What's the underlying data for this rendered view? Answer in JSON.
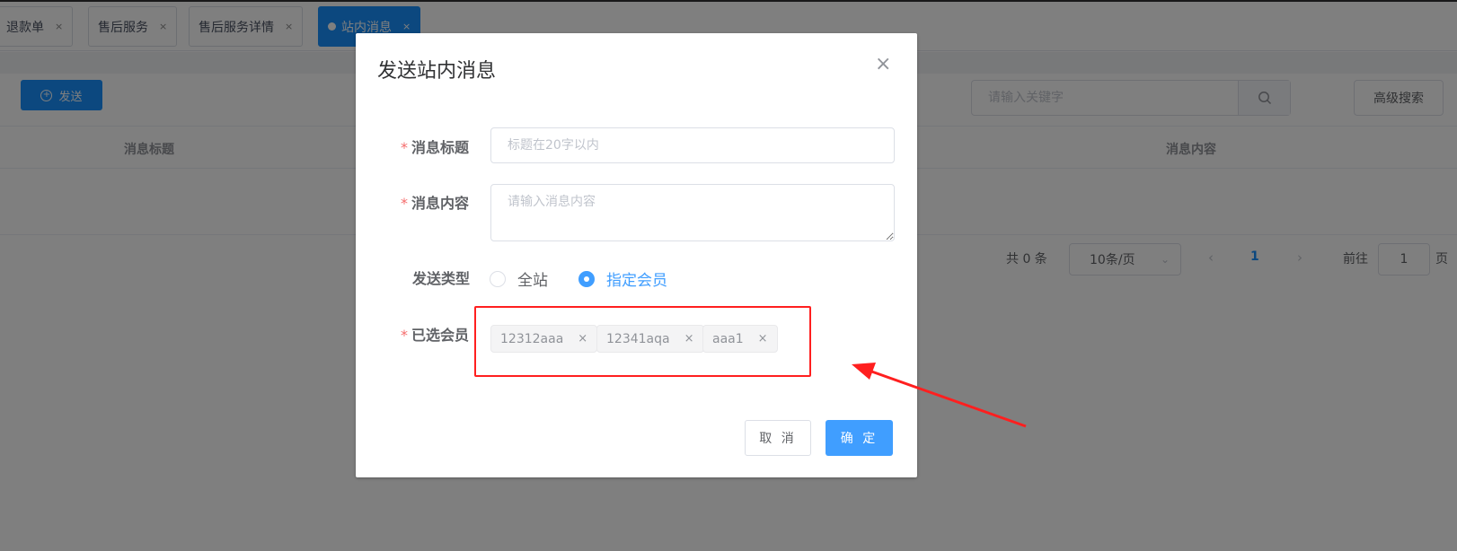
{
  "tabs": [
    {
      "label": "退款单",
      "close": "×"
    },
    {
      "label": "售后服务",
      "close": "×"
    },
    {
      "label": "售后服务详情",
      "close": "×"
    },
    {
      "label": "站内消息",
      "close": "×",
      "active": true
    }
  ],
  "toolbar": {
    "send_label": "发送",
    "search_placeholder": "请输入关键字",
    "advanced_search_label": "高级搜索"
  },
  "table": {
    "columns": [
      "消息标题",
      "消息内容"
    ]
  },
  "pagination": {
    "total_text": "共 0 条",
    "page_size": "10条/页",
    "current_page": "1",
    "goto_label": "前往",
    "goto_value": "1",
    "page_suffix": "页"
  },
  "dialog": {
    "title": "发送站内消息",
    "close": "×",
    "fields": {
      "title_label": "消息标题",
      "title_placeholder": "标题在20字以内",
      "content_label": "消息内容",
      "content_placeholder": "请输入消息内容",
      "type_label": "发送类型",
      "type_options": [
        {
          "label": "全站",
          "checked": false
        },
        {
          "label": "指定会员",
          "checked": true
        }
      ],
      "members_label": "已选会员",
      "selected_members": [
        "12312aaa",
        "12341aqa",
        "aaa1"
      ],
      "required_mark": "*"
    },
    "buttons": {
      "cancel": "取 消",
      "confirm": "确 定"
    }
  },
  "colors": {
    "primary": "#409eff",
    "tab_active": "#1890ff",
    "required": "#f56c6c",
    "annotation": "#ff1f1f"
  },
  "icons": {
    "search": "search-icon",
    "plus": "plus-circle-icon",
    "close": "close-icon"
  }
}
